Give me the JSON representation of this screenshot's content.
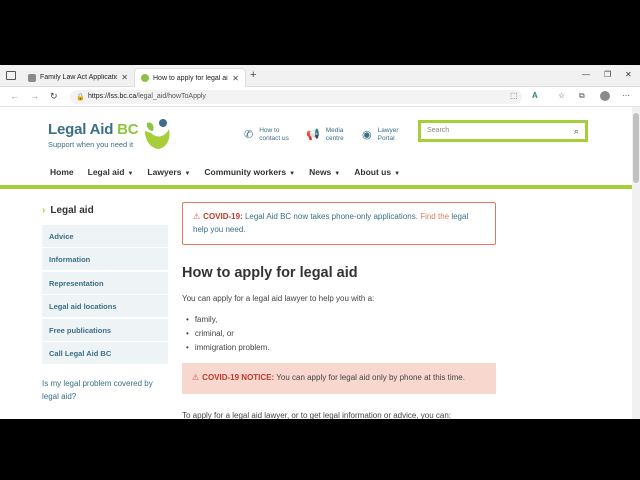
{
  "browser": {
    "tabs": [
      {
        "title": "Family Law Act Application"
      },
      {
        "title": "How to apply for legal aid | Legal Aid BC"
      }
    ],
    "new_tab_icon": "+",
    "url_host": "https://lss.bc.ca",
    "url_path": "/legal_aid/howToApply",
    "window_controls": [
      "—",
      "❐",
      "✕"
    ]
  },
  "header": {
    "logo_name": "Legal Aid",
    "logo_name_accent": "BC",
    "tagline": "Support when you need it",
    "contact_label_1": "How to",
    "contact_label_2": "contact us",
    "media_label_1": "Media",
    "media_label_2": "centre",
    "lawyer_label_1": "Lawyer",
    "lawyer_label_2": "Portal",
    "search_placeholder": "Search"
  },
  "nav": {
    "home": "Home",
    "legal_aid": "Legal aid",
    "lawyers": "Lawyers",
    "community_workers": "Community workers",
    "news": "News",
    "about_us": "About us"
  },
  "sidebar": {
    "heading": "Legal aid",
    "items": [
      {
        "label": "Advice"
      },
      {
        "label": "Information"
      },
      {
        "label": "Representation"
      },
      {
        "label": "Legal aid locations"
      },
      {
        "label": "Free publications"
      },
      {
        "label": "Call Legal Aid BC"
      }
    ],
    "question": "Is my legal problem covered by legal aid?"
  },
  "content": {
    "alert1_label": "COVID-19:",
    "alert1_text": " Legal Aid BC now takes phone-only applications. ",
    "alert1_find": "Find the",
    "alert1_link": " legal help you need.",
    "title": "How to apply for legal aid",
    "intro": "You can apply for a legal aid lawyer to help you with a:",
    "bullets": [
      "family,",
      "criminal, or",
      "immigration problem."
    ],
    "alert2_label": "COVID-19 NOTICE:",
    "alert2_text": " You can apply for legal aid only by phone at this time.",
    "cut_text": "To apply for a legal aid lawyer, or to get legal information or advice, you can:"
  },
  "colors": {
    "brand_blue": "#3a6f86",
    "brand_green": "#a6ce39",
    "alert_red": "#c0392b"
  }
}
